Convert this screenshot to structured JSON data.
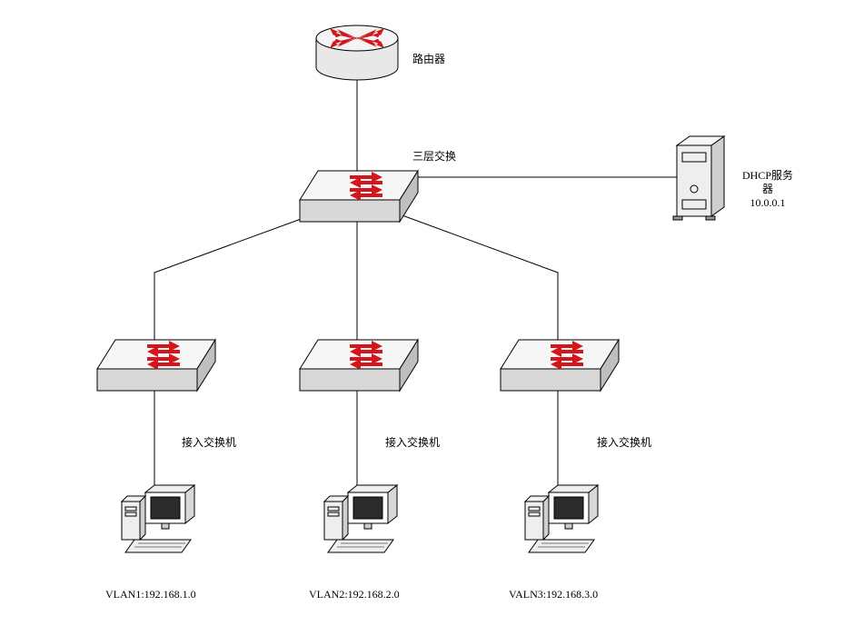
{
  "labels": {
    "router": "路由器",
    "l3switch": "三层交换",
    "dhcp_line1": "DHCP服务",
    "dhcp_line2": "器",
    "dhcp_ip": "10.0.0.1",
    "access1": "接入交换机",
    "access2": "接入交换机",
    "access3": "接入交换机",
    "vlan1": "VLAN1:192.168.1.0",
    "vlan2": "VLAN2:192.168.2.0",
    "vlan3": "VALN3:192.168.3.0"
  },
  "chart_data": {
    "type": "network-topology",
    "nodes": [
      {
        "id": "router",
        "type": "router",
        "label": "路由器"
      },
      {
        "id": "l3sw",
        "type": "layer3-switch",
        "label": "三层交换"
      },
      {
        "id": "dhcp",
        "type": "server",
        "label": "DHCP服务器",
        "ip": "10.0.0.1"
      },
      {
        "id": "sw1",
        "type": "access-switch",
        "label": "接入交换机"
      },
      {
        "id": "sw2",
        "type": "access-switch",
        "label": "接入交换机"
      },
      {
        "id": "sw3",
        "type": "access-switch",
        "label": "接入交换机"
      },
      {
        "id": "pc1",
        "type": "pc",
        "vlan": "VLAN1",
        "subnet": "192.168.1.0"
      },
      {
        "id": "pc2",
        "type": "pc",
        "vlan": "VLAN2",
        "subnet": "192.168.2.0"
      },
      {
        "id": "pc3",
        "type": "pc",
        "vlan": "VALN3",
        "subnet": "192.168.3.0"
      }
    ],
    "links": [
      {
        "from": "router",
        "to": "l3sw"
      },
      {
        "from": "l3sw",
        "to": "dhcp"
      },
      {
        "from": "l3sw",
        "to": "sw1"
      },
      {
        "from": "l3sw",
        "to": "sw2"
      },
      {
        "from": "l3sw",
        "to": "sw3"
      },
      {
        "from": "sw1",
        "to": "pc1"
      },
      {
        "from": "sw2",
        "to": "pc2"
      },
      {
        "from": "sw3",
        "to": "pc3"
      }
    ]
  }
}
